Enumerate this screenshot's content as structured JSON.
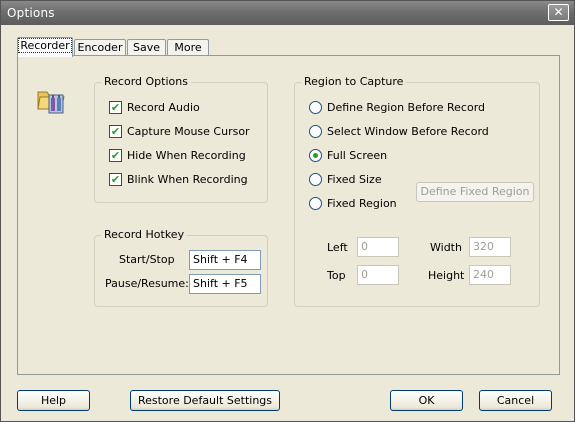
{
  "window": {
    "title": "Options",
    "close_glyph": "✕"
  },
  "tabs": [
    {
      "label": "Recorder",
      "active": true
    },
    {
      "label": "Encoder",
      "active": false
    },
    {
      "label": "Save",
      "active": false
    },
    {
      "label": "More",
      "active": false
    }
  ],
  "record_options": {
    "title": "Record Options",
    "items": [
      {
        "label": "Record Audio",
        "checked": true
      },
      {
        "label": "Capture Mouse Cursor",
        "checked": true
      },
      {
        "label": "Hide When Recording",
        "checked": true
      },
      {
        "label": "Blink When Recording",
        "checked": true
      }
    ]
  },
  "record_hotkey": {
    "title": "Record Hotkey",
    "start_stop_label": "Start/Stop",
    "start_stop_value": "Shift + F4",
    "pause_resume_label": "Pause/Resume:",
    "pause_resume_value": "Shift + F5"
  },
  "region": {
    "title": "Region to Capture",
    "options": [
      {
        "label": "Define Region Before Record",
        "selected": false
      },
      {
        "label": "Select Window Before Record",
        "selected": false
      },
      {
        "label": "Full Screen",
        "selected": true
      },
      {
        "label": "Fixed Size",
        "selected": false
      },
      {
        "label": "Fixed Region",
        "selected": false
      }
    ],
    "define_fixed_region_label": "Define Fixed Region",
    "left_label": "Left",
    "left_value": "0",
    "top_label": "Top",
    "top_value": "0",
    "width_label": "Width",
    "width_value": "320",
    "height_label": "Height",
    "height_value": "240"
  },
  "footer": {
    "help_label": "Help",
    "restore_label": "Restore Default Settings",
    "ok_label": "OK",
    "cancel_label": "Cancel"
  },
  "check_glyph": "✔",
  "colors": {
    "check": "#21a121",
    "titlebar": "#6e6e6e",
    "dialog": "#ece9d8"
  }
}
